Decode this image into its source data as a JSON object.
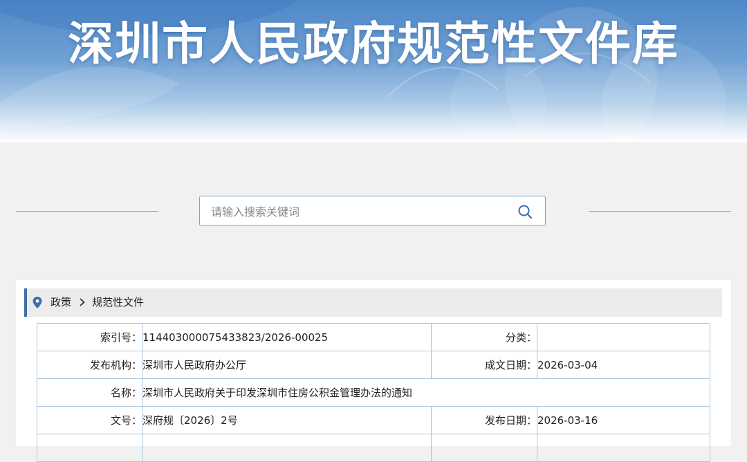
{
  "banner": {
    "title": "深圳市人民政府规范性文件库"
  },
  "search": {
    "placeholder": "请输入搜索关键词",
    "icon": "search-icon"
  },
  "breadcrumb": {
    "icon": "location-pin-icon",
    "items": [
      "政策",
      "规范性文件"
    ]
  },
  "info": {
    "index_no": {
      "label": "索引号：",
      "value": "11440300007543382​3/2026-00025"
    },
    "category": {
      "label": "分类：",
      "value": ""
    },
    "publisher": {
      "label": "发布机构：",
      "value": "深圳市人民政府办公厅"
    },
    "written_date": {
      "label": "成文日期：",
      "value": "2026-03-04"
    },
    "name": {
      "label": "名称：",
      "value": "深圳市人民政府关于印发深圳市住房公积金管理办法的通知"
    },
    "doc_no": {
      "label": "文号：",
      "value": "深府规〔2026〕2号"
    },
    "publish_date": {
      "label": "发布日期：",
      "value": "2026-03-16"
    }
  },
  "colors": {
    "accent": "#3d6fa6",
    "border": "#a9c3dc",
    "banner": "#5b91cc"
  }
}
